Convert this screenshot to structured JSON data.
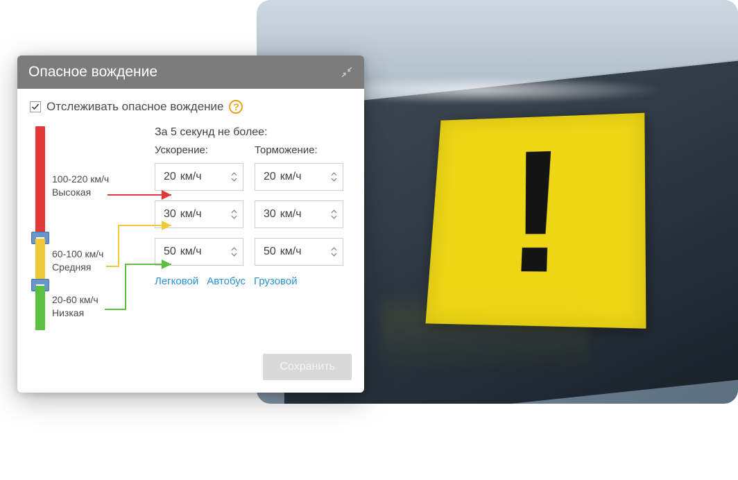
{
  "panel": {
    "title": "Опасное вождение",
    "track_label": "Отслеживать опасное вождение",
    "header_text": "За 5 секунд не более:",
    "col_accel": "Ускорение:",
    "col_brake": "Торможение:",
    "unit": "км/ч",
    "ranges": {
      "high": {
        "range": "100-220 км/ч",
        "name": "Высокая"
      },
      "mid": {
        "range": "60-100 км/ч",
        "name": "Средняя"
      },
      "low": {
        "range": "20-60 км/ч",
        "name": "Низкая"
      }
    },
    "rows": [
      {
        "accel": "20",
        "brake": "20"
      },
      {
        "accel": "30",
        "brake": "30"
      },
      {
        "accel": "50",
        "brake": "50"
      }
    ],
    "presets": {
      "car": "Легковой",
      "bus": "Автобус",
      "truck": "Грузовой"
    },
    "save_label": "Сохранить"
  },
  "colors": {
    "high": "#e33838",
    "mid": "#f0c93a",
    "low": "#5bbf3f"
  }
}
